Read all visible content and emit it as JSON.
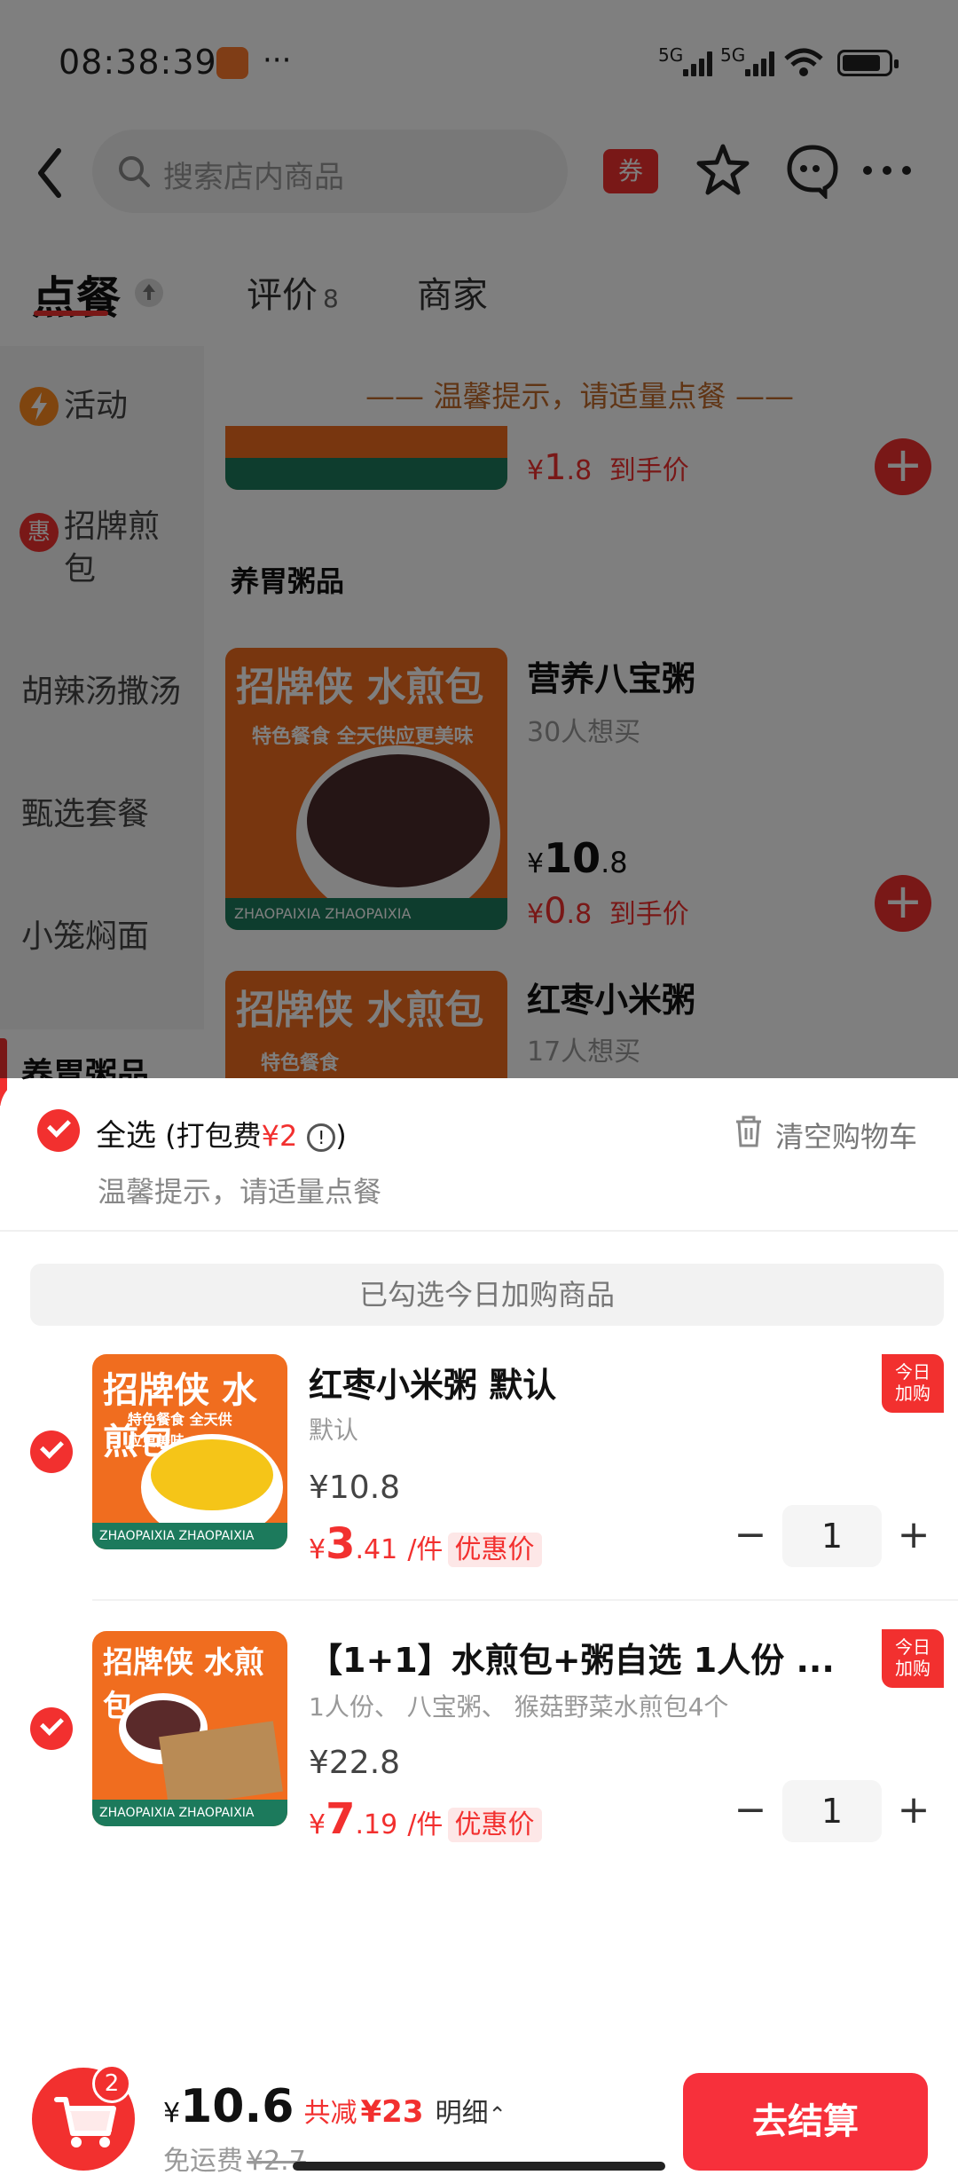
{
  "status_bar": {
    "time": "08:38:39",
    "dots": "···",
    "net1": "5G",
    "net2": "5G"
  },
  "header": {
    "search_placeholder": "搜索店内商品",
    "coupon_label": "券"
  },
  "tabs": {
    "order": "点餐",
    "reviews": "评价",
    "reviews_count": "8",
    "merchant": "商家"
  },
  "sidebar": {
    "items": [
      "活动",
      "招牌煎包",
      "胡辣汤撒汤",
      "甄选套餐",
      "小笼焖面",
      "养胃粥品"
    ],
    "hui": "惠"
  },
  "menu": {
    "tip": "—— 温馨提示，请适量点餐 ——",
    "prev_price_symbol": "¥",
    "prev_price_int": "1",
    "prev_price_dec": ".8",
    "prev_price_suffix": "到手价",
    "section_title": "养胃粥品",
    "products": [
      {
        "name": "营养八宝粥",
        "want": "30人想买",
        "price_int": "10",
        "price_dec": ".8",
        "deal_int": "0",
        "deal_dec": ".8",
        "deal_suffix": "到手价",
        "brand": "招牌侠 水煎包",
        "slogan": "特色餐食 全天供应更美味",
        "strip": "ZHAOPAIXIA ZHAOPAIXIA"
      },
      {
        "name": "红枣小米粥",
        "want": "17人想买",
        "brand": "招牌侠 水煎包",
        "slogan": "特色餐食"
      }
    ]
  },
  "cart": {
    "select_all": "全选",
    "packing_prefix": " (打包费",
    "packing_fee": "¥2",
    "info_icon": "!",
    "packing_suffix": ")",
    "clear": "清空购物车",
    "tip": "温馨提示，请适量点餐",
    "notice": "已勾选今日加购商品",
    "badge_line1": "今日",
    "badge_line2": "加购",
    "items": [
      {
        "title": "红枣小米粥 默认",
        "spec": "默认",
        "orig": "¥10.8",
        "deal_symbol": "¥",
        "deal_int": "3",
        "deal_dec": ".41",
        "unit": "/件",
        "tag": "优惠价",
        "qty": "1",
        "brand": "招牌侠 水煎包",
        "slogan": "特色餐食 全天供应更美味",
        "strip": "ZHAOPAIXIA ZHAOPAIXIA"
      },
      {
        "title": "【1+1】水煎包+粥自选 1人份 ...",
        "spec": "1人份、 八宝粥、 猴菇野菜水煎包4个",
        "orig": "¥22.8",
        "deal_symbol": "¥",
        "deal_int": "7",
        "deal_dec": ".19",
        "unit": "/件",
        "tag": "优惠价",
        "qty": "1",
        "brand": "招牌侠 水煎包",
        "strip": "ZHAOPAIXIA ZHAOPAIXIA"
      }
    ],
    "minus": "−",
    "plus": "+"
  },
  "footer": {
    "cart_count": "2",
    "total_symbol": "¥",
    "total": "10.6",
    "saved_label": "共减",
    "saved": "¥23",
    "detail": "明细",
    "detail_arrow": "⌃",
    "delivery": "免运费",
    "delivery_orig": "¥2.7",
    "checkout": "去结算"
  }
}
